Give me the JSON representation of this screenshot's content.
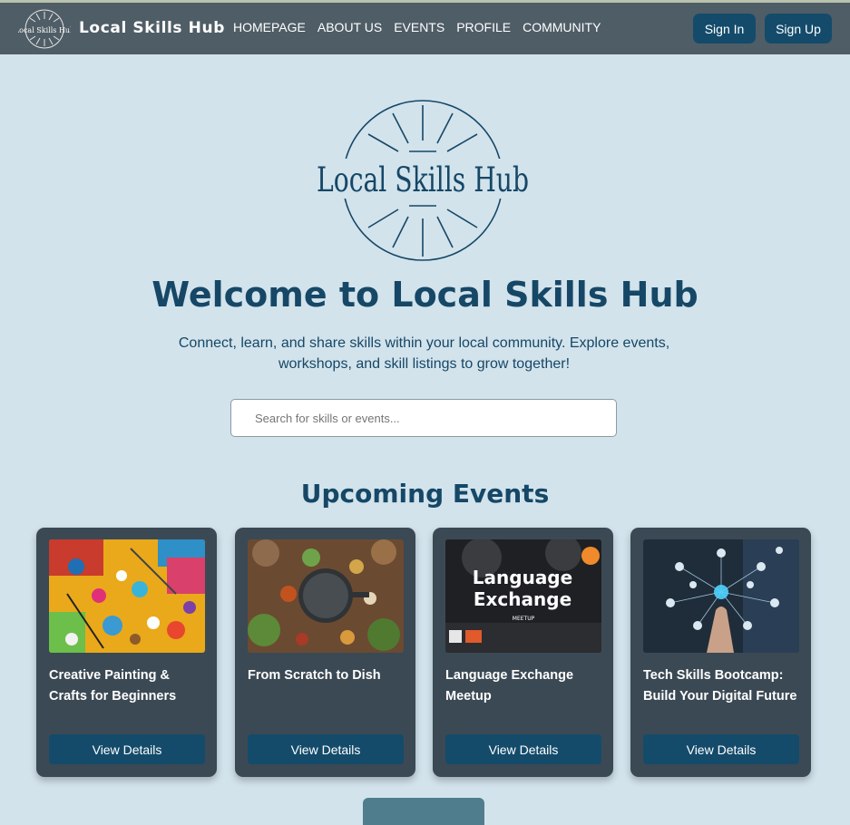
{
  "nav": {
    "logo_text": "Local Skills Hub",
    "brand": "Local Skills Hub",
    "links": [
      "HOMEPAGE",
      "ABOUT US",
      "EVENTS",
      "PROFILE",
      "COMMUNITY"
    ],
    "sign_in": "Sign In",
    "sign_up": "Sign Up"
  },
  "hero": {
    "logo_text": "Local Skills Hub",
    "title": "Welcome to Local Skills Hub",
    "subtitle": "Connect, learn, and share skills within your local community. Explore events, workshops, and skill listings to grow together!",
    "search_placeholder": "Search for skills or events..."
  },
  "events": {
    "heading": "Upcoming Events",
    "cards": [
      {
        "title": "Creative Painting & Crafts for Beginners",
        "button": "View Details",
        "image": "craft-supplies-image"
      },
      {
        "title": "From Scratch to Dish",
        "button": "View Details",
        "image": "cooking-ingredients-image"
      },
      {
        "title": "Language Exchange Meetup",
        "button": "View Details",
        "image": "language-exchange-image",
        "image_text": "Language Exchange",
        "image_subtext": "MEETUP"
      },
      {
        "title": "Tech Skills Bootcamp: Build Your Digital Future",
        "button": "View Details",
        "image": "tech-network-image"
      }
    ]
  },
  "colors": {
    "nav_bg": "#4f5d66",
    "page_bg": "#d2e3ec",
    "primary": "#144b6b",
    "heading": "#164766",
    "card_bg": "#3b4954"
  }
}
